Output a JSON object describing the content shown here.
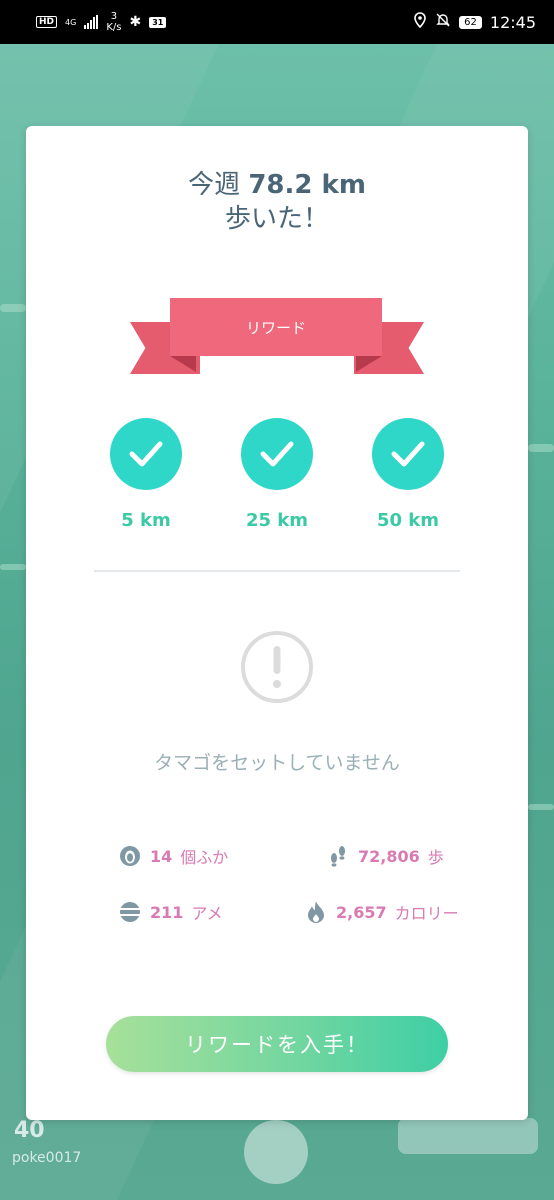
{
  "status_bar": {
    "hd": "HD",
    "network": "4G",
    "speed_value": "3",
    "speed_unit": "K/s",
    "calendar_day": "31",
    "battery": "62",
    "time": "12:45"
  },
  "card": {
    "title_prefix": "今週",
    "title_distance": "78.2 km",
    "title_line2": "歩いた！",
    "ribbon_label": "リワード",
    "milestones": [
      {
        "label": "5 km",
        "achieved": true
      },
      {
        "label": "25 km",
        "achieved": true
      },
      {
        "label": "50 km",
        "achieved": true
      }
    ],
    "no_egg_message": "タマゴをセットしていません",
    "stats": {
      "hatched": {
        "value": "14",
        "unit": "個ふか",
        "icon": "egg-icon"
      },
      "steps": {
        "value": "72,806",
        "unit": "歩",
        "icon": "footprints-icon"
      },
      "candy": {
        "value": "211",
        "unit": "アメ",
        "icon": "candy-icon"
      },
      "calories": {
        "value": "2,657",
        "unit": "カロリー",
        "icon": "flame-icon"
      }
    },
    "button_label": "リワードを入手！"
  },
  "hud": {
    "level": "40",
    "trainer_name": "poke0017"
  },
  "colors": {
    "accent": "#2fd7c9",
    "ribbon": "#f0687c",
    "stat_value": "#d97ab2",
    "title": "#4a6676"
  }
}
